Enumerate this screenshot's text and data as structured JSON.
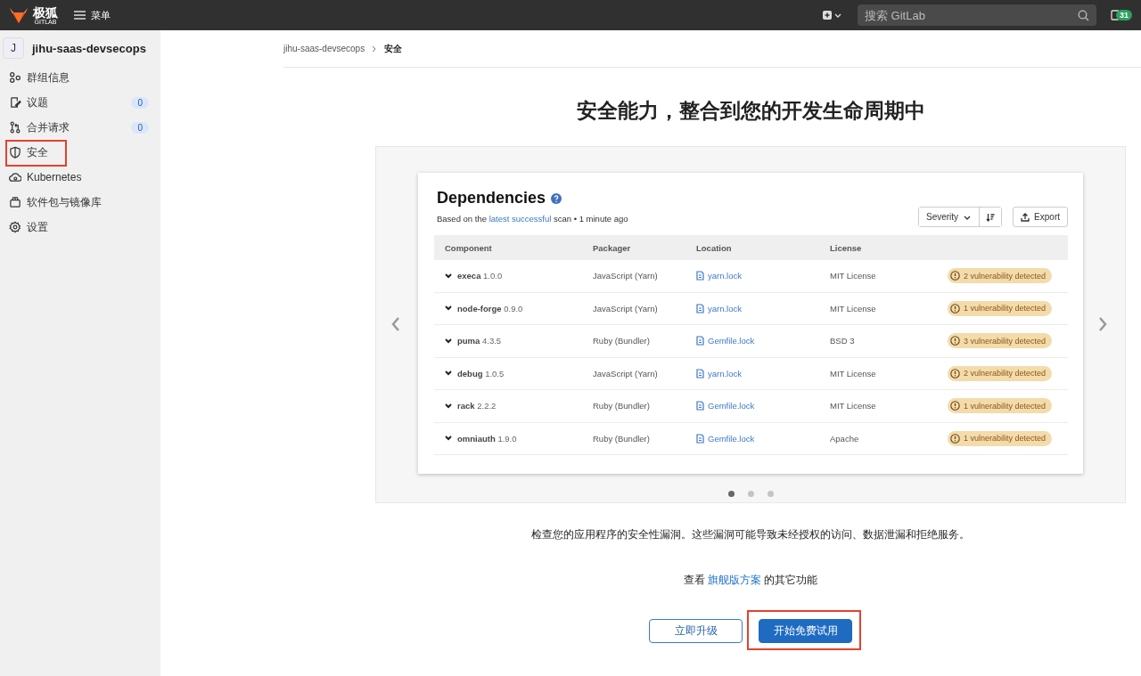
{
  "topbar": {
    "logo_text": "极狐",
    "logo_subtext": "GITLAB",
    "menu_label": "菜单",
    "search": {
      "placeholder": "搜索 GitLab"
    },
    "todo_count": "31"
  },
  "sidebar": {
    "group": {
      "avatar": "J",
      "name": "jihu-saas-devsecops"
    },
    "items": [
      {
        "label": "群组信息",
        "highlighted": false
      },
      {
        "label": "议题",
        "count": "0",
        "highlighted": false
      },
      {
        "label": "合并请求",
        "count": "0",
        "highlighted": false
      },
      {
        "label": "安全",
        "highlighted": true
      },
      {
        "label": "Kubernetes",
        "highlighted": false
      },
      {
        "label": "软件包与镜像库",
        "highlighted": false
      },
      {
        "label": "设置",
        "highlighted": false
      }
    ]
  },
  "breadcrumb": [
    "jihu-saas-devsecops",
    "安全"
  ],
  "title": "安全能力，整合到您的开发生命周期中",
  "carousel": {
    "slide": {
      "title": "Dependencies",
      "subtitle_before": "Based on the",
      "subtitle_link": "latest successful",
      "subtitle_after": "scan • 1 minute ago",
      "sort_label": "Severity",
      "export_label": "Export",
      "columns": [
        "Component",
        "Packager",
        "Location",
        "License"
      ],
      "rows": [
        {
          "name": "execa",
          "version": "1.0.0",
          "packager": "JavaScript (Yarn)",
          "location": "yarn.lock",
          "license": "MIT License",
          "vulnerabilities": "2 vulnerability detected"
        },
        {
          "name": "node-forge",
          "version": "0.9.0",
          "packager": "JavaScript (Yarn)",
          "location": "yarn.lock",
          "license": "MIT License",
          "vulnerabilities": "1 vulnerability detected"
        },
        {
          "name": "puma",
          "version": "4.3.5",
          "packager": "Ruby (Bundler)",
          "location": "Gemfile.lock",
          "license": "BSD 3",
          "vulnerabilities": "3 vulnerability detected"
        },
        {
          "name": "debug",
          "version": "1.0.5",
          "packager": "JavaScript (Yarn)",
          "location": "yarn.lock",
          "license": "MIT License",
          "vulnerabilities": "2 vulnerability detected"
        },
        {
          "name": "rack",
          "version": "2.2.2",
          "packager": "Ruby (Bundler)",
          "location": "Gemfile.lock",
          "license": "MIT License",
          "vulnerabilities": "1 vulnerability detected"
        },
        {
          "name": "omniauth",
          "version": "1.9.0",
          "packager": "Ruby (Bundler)",
          "location": "Gemfile.lock",
          "license": "Apache",
          "vulnerabilities": "1 vulnerability detected"
        }
      ]
    },
    "dots": [
      {
        "selected": true
      },
      {
        "selected": false
      },
      {
        "selected": false
      }
    ]
  },
  "description": "检查您的应用程序的安全性漏洞。这些漏洞可能导致未经授权的访问、数据泄漏和拒绝服务。",
  "more": {
    "before": "查看",
    "link": "旗舰版方案",
    "after": "的其它功能"
  },
  "buttons": [
    {
      "label": "立即升级",
      "kind": "secondary",
      "highlighted": false
    },
    {
      "label": "开始免费试用",
      "kind": "primary",
      "highlighted": true
    }
  ]
}
